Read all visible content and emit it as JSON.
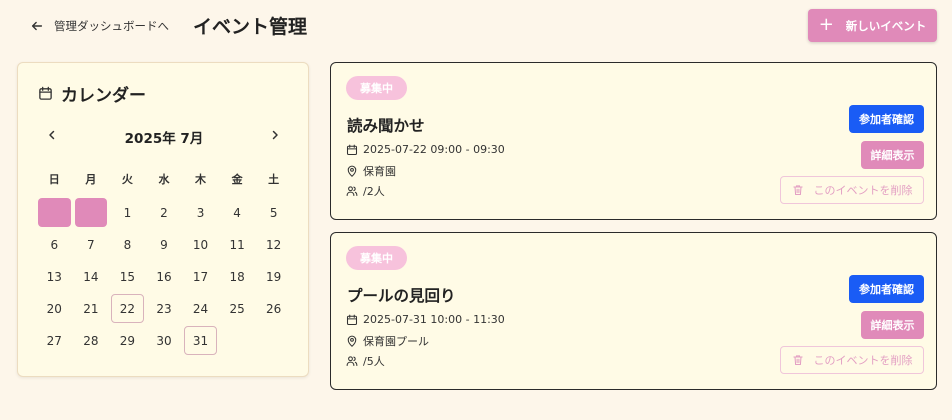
{
  "header": {
    "back_label": "管理ダッシュボードへ",
    "title": "イベント管理",
    "new_event_label": "新しいイベント"
  },
  "calendar": {
    "title": "カレンダー",
    "month_label": "2025年 7月",
    "weekdays": [
      "日",
      "月",
      "火",
      "水",
      "木",
      "金",
      "土"
    ],
    "weeks": [
      [
        "",
        "",
        "1",
        "2",
        "3",
        "4",
        "5"
      ],
      [
        "6",
        "7",
        "8",
        "9",
        "10",
        "11",
        "12"
      ],
      [
        "13",
        "14",
        "15",
        "16",
        "17",
        "18",
        "19"
      ],
      [
        "20",
        "21",
        "22",
        "23",
        "24",
        "25",
        "26"
      ],
      [
        "27",
        "28",
        "29",
        "30",
        "31",
        "",
        ""
      ]
    ],
    "event_days": [
      "22",
      "31"
    ]
  },
  "events": [
    {
      "status": "募集中",
      "title": "読み聞かせ",
      "datetime": "2025-07-22 09:00 - 09:30",
      "place": "保育園",
      "participants": "/2人",
      "confirm_label": "参加者確認",
      "detail_label": "詳細表示",
      "delete_label": "このイベントを削除"
    },
    {
      "status": "募集中",
      "title": "プールの見回り",
      "datetime": "2025-07-31 10:00 - 11:30",
      "place": "保育園プール",
      "participants": "/5人",
      "confirm_label": "参加者確認",
      "detail_label": "詳細表示",
      "delete_label": "このイベントを削除"
    }
  ],
  "colors": {
    "background": "#fdf6ea",
    "accent_pink": "#e08ab9",
    "badge_pink": "#f7c2dc",
    "primary_blue": "#1a5cf5",
    "card_bg": "#fffbe6"
  },
  "icons": {
    "back": "arrow-left-icon",
    "new": "plus-icon",
    "calendar": "calendar-icon",
    "prev": "chevron-left-icon",
    "next": "chevron-right-icon",
    "date": "calendar-icon",
    "place": "map-pin-icon",
    "people": "users-icon",
    "delete": "trash-icon"
  }
}
